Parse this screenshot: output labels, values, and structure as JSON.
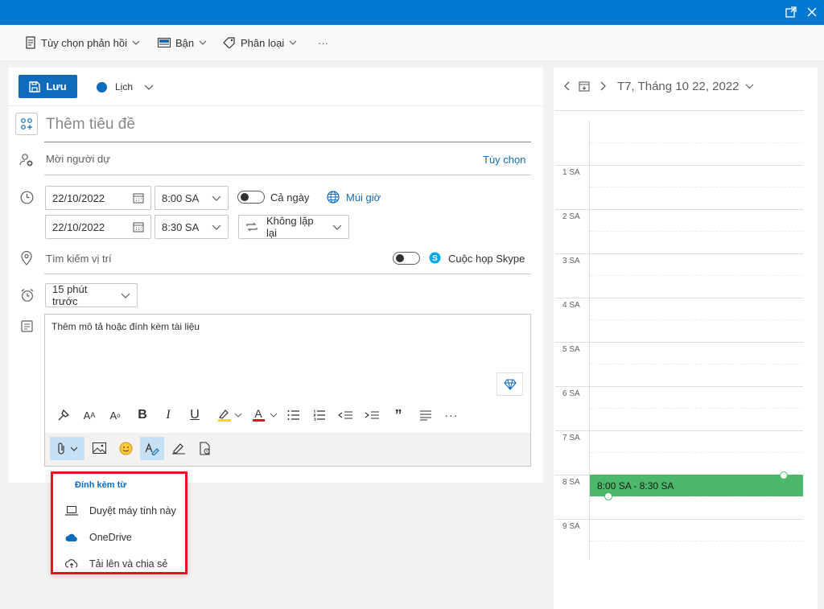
{
  "ribbon": {
    "reply_options": "Tùy chọn phản hồi",
    "status": "Bận",
    "categorize": "Phân loại",
    "more": "···"
  },
  "form": {
    "save_label": "Lưu",
    "calendar_name": "Lịch",
    "title_placeholder": "Thêm tiêu đề",
    "attendees_placeholder": "Mời người dự",
    "options_link": "Tùy chọn",
    "start_date": "22/10/2022",
    "start_time": "8:00 SA",
    "all_day_label": "Cả ngày",
    "timezone_label": "Múi giờ",
    "end_date": "22/10/2022",
    "end_time": "8:30 SA",
    "repeat_label": "Không lặp lại",
    "location_placeholder": "Tìm kiếm vị trí",
    "skype_label": "Cuộc họp Skype",
    "reminder": "15 phút trước",
    "description_placeholder": "Thêm mô tả hoặc đính kèm tài liệu"
  },
  "attach_menu": {
    "header": "Đính kèm từ",
    "items": [
      {
        "label": "Duyệt máy tính này",
        "icon": "laptop-icon"
      },
      {
        "label": "OneDrive",
        "icon": "onedrive-cloud-icon"
      },
      {
        "label": "Tải lên và chia sẻ",
        "icon": "cloud-upload-icon"
      }
    ]
  },
  "calendar": {
    "date_title": "T7, Tháng 10 22, 2022",
    "hours": [
      "1 SA",
      "2 SA",
      "3 SA",
      "4 SA",
      "5 SA",
      "6 SA",
      "7 SA",
      "8 SA",
      "9 SA"
    ],
    "event_time": "8:00 SA - 8:30 SA",
    "event_color": "#4cb869"
  },
  "colors": {
    "accent": "#0f6cbd",
    "titlebar": "#0078d4",
    "highlight_border": "#e81123"
  }
}
